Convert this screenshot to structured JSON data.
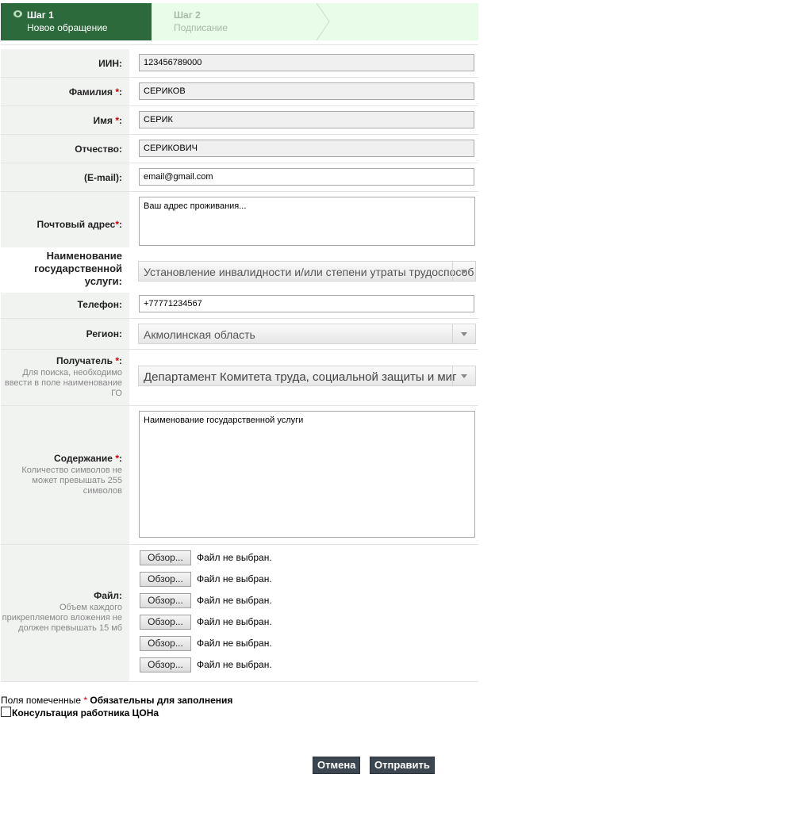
{
  "steps": [
    {
      "title": "Шаг 1",
      "subtitle": "Новое обращение"
    },
    {
      "title": "Шаг 2",
      "subtitle": "Подписание"
    }
  ],
  "fields": {
    "iin": {
      "label": "ИИН:",
      "value": "123456789000"
    },
    "surname": {
      "label": "Фамилия",
      "req": "*",
      "colon": ":",
      "value": "СЕРИКОВ"
    },
    "name": {
      "label": "Имя",
      "req": "*",
      "colon": ":",
      "value": "СЕРИК"
    },
    "patronymic": {
      "label": "Отчество:",
      "value": "СЕРИКОВИЧ"
    },
    "email": {
      "label": "(E-mail):",
      "value": "email@gmail.com"
    },
    "address": {
      "label": "Почтовый адрес",
      "req": "*",
      "colon": ":",
      "value": "Ваш адрес проживания..."
    },
    "service": {
      "label": "Наименование государственной услуги:",
      "value": "Установление инвалидности и/или степени утраты трудоспособ"
    },
    "phone": {
      "label": "Телефон:",
      "value": "+77771234567"
    },
    "region": {
      "label": "Регион:",
      "value": "Акмолинская область"
    },
    "recipient": {
      "label": "Получатель",
      "req": "*",
      "colon": ":",
      "hint": "Для поиска, необходимо ввести в поле наименование ГО",
      "value": "Департамент Комитета труда, социальной защиты и миг"
    },
    "content": {
      "label": "Содержание",
      "req": "*",
      "colon": ":",
      "hint": "Количество символов не может превышать 255 символов",
      "value": "Наименование государственной услуги"
    },
    "file": {
      "label": "Файл:",
      "hint": "Объем каждого прикрепляемого вложения не должен превышать 15 мб",
      "button": "Обзор...",
      "status": "Файл не выбран."
    }
  },
  "note": {
    "prefix": "Поля помеченные",
    "req": "*",
    "bold": "Обязательны для заполнения"
  },
  "consult_label": "Консультация работника ЦОНа",
  "buttons": {
    "cancel": "Отмена",
    "submit": "Отправить"
  }
}
